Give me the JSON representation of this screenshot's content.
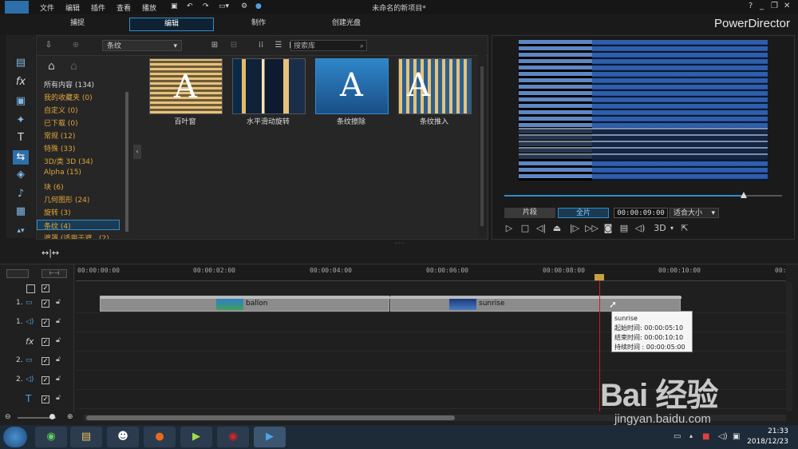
{
  "menubar": {
    "items": [
      "文件",
      "编辑",
      "插件",
      "查看",
      "播放"
    ],
    "doc_title": "未命名的新项目*",
    "window_controls": [
      "?",
      "_",
      "❐",
      "✕"
    ]
  },
  "modes": {
    "tabs": [
      "捕捉",
      "编辑",
      "制作",
      "创建光盘"
    ],
    "active": "编辑",
    "brand": "PowerDirector"
  },
  "tools": [
    "media-room-icon",
    "effect-fx-icon",
    "pip-icon",
    "particle-icon",
    "title-t-icon",
    "transition-icon",
    "audio-mixing-icon",
    "voice-record-icon",
    "chapter-icon",
    "subtitle-icon"
  ],
  "library": {
    "category_select": "条纹",
    "search_placeholder": "搜索库",
    "categories": [
      {
        "label": "所有内容 (134)",
        "color": "white"
      },
      {
        "label": "我的收藏夹 (0)",
        "color": "orange"
      },
      {
        "label": "自定义 (0)",
        "color": "orange"
      },
      {
        "label": "已下载 (0)",
        "color": "orange"
      },
      {
        "label": "常规 (12)",
        "color": "orange"
      },
      {
        "label": "特殊 (33)",
        "color": "orange"
      },
      {
        "label": "3D/类 3D (34)",
        "color": "orange"
      },
      {
        "label": "Alpha (15)",
        "color": "orange"
      },
      {
        "label": "块 (6)",
        "color": "orange"
      },
      {
        "label": "几何图形 (24)",
        "color": "orange"
      },
      {
        "label": "旋转 (3)",
        "color": "orange"
      },
      {
        "label": "条纹 (4)",
        "color": "orange",
        "selected": true
      },
      {
        "label": "遮罩 (适用于遮...(2)",
        "color": "orange"
      }
    ],
    "transitions": [
      {
        "label": "百叶窗"
      },
      {
        "label": "水平滑动旋转"
      },
      {
        "label": "条纹擦除"
      },
      {
        "label": "条纹推入"
      }
    ]
  },
  "preview": {
    "mode_clip": "片段",
    "mode_movie": "全片",
    "timecode": "00:00:09:00",
    "fit": "适合大小",
    "label_3d": "3D",
    "progress": 0.87
  },
  "timeline": {
    "ruler": [
      "00:00:00:00",
      "00:00:02:00",
      "00:00:04:00",
      "00:00:06:00",
      "00:00:08:00",
      "00:00:10:00",
      "00:"
    ],
    "tracks": [
      {
        "label": "1.",
        "kind": "video"
      },
      {
        "label": "1.",
        "kind": "audio"
      },
      {
        "label": "fx",
        "kind": "effect"
      },
      {
        "label": "2.",
        "kind": "video"
      },
      {
        "label": "2.",
        "kind": "audio"
      },
      {
        "label": "T",
        "kind": "title"
      }
    ],
    "clips": [
      {
        "name": "ballon"
      },
      {
        "name": "sunrise"
      }
    ],
    "tooltip": {
      "title": "sunrise",
      "start": "起始时间: 00:00:05:10",
      "end": "结束时间: 00:00:10:10",
      "duration": "持续时间 : 00:00:05:00"
    }
  },
  "taskbar": {
    "time": "21:33",
    "date": "2018/12/23"
  },
  "watermark": {
    "logo": "Bai 经验",
    "url": "jingyan.baidu.com"
  }
}
